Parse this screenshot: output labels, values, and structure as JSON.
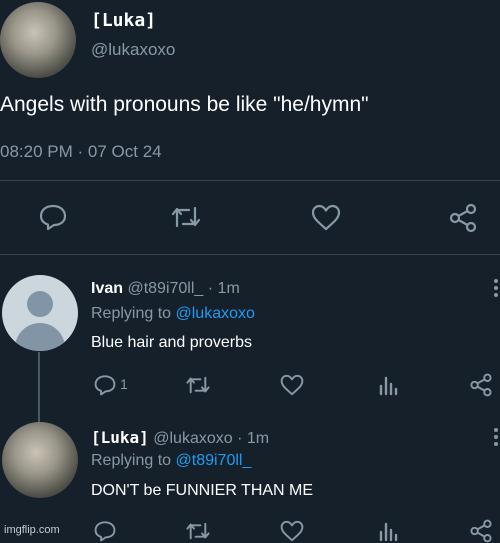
{
  "main_tweet": {
    "display_name": "[Luka]",
    "handle": "@lukaxoxo",
    "text": "Angels with pronouns be like \"he/hymn\"",
    "time": "08:20 PM",
    "separator": "·",
    "date": "07 Oct 24"
  },
  "reply1": {
    "display_name": "Ivan",
    "handle": "@t89i70ll_",
    "time": "· 1m",
    "replying_prefix": "Replying to",
    "replying_handle": "@lukaxoxo",
    "text": "Blue hair and proverbs",
    "reply_count": "1"
  },
  "reply2": {
    "display_name": "[Luka]",
    "handle": "@lukaxoxo",
    "time": "· 1m",
    "replying_prefix": "Replying to",
    "replying_handle": "@t89i70ll_",
    "text": "DON'T be FUNNIER THAN ME"
  },
  "watermark": "imgflip.com",
  "colors": {
    "background": "#15202b",
    "secondary_text": "#8899a6",
    "link": "#1d9bf0",
    "divider": "#38444d"
  },
  "icons": [
    "reply-icon",
    "retweet-icon",
    "like-icon",
    "share-icon",
    "analytics-icon",
    "more-icon"
  ]
}
